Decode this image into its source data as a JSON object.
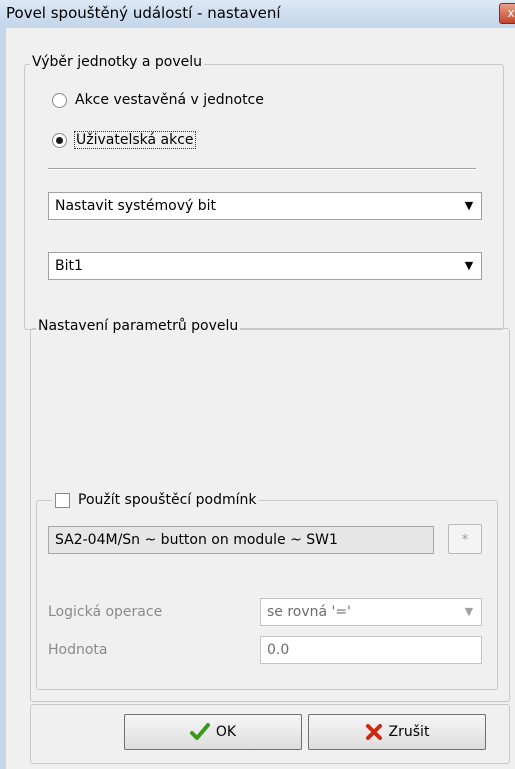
{
  "window": {
    "title": "Povel spouštěný událostí - nastavení",
    "close_glyph": "x"
  },
  "group1": {
    "legend": "Výběr jednotky a povelu",
    "radio_builtin": "Akce vestavěná v jednotce",
    "radio_user": "Uživatelská akce",
    "selected": "radio_user",
    "combo_action": "Nastavit systémový bit",
    "combo_bit": "Bit1"
  },
  "group2": {
    "legend": "Nastavení parametrů povelu",
    "condition": {
      "checkbox_label": "Použít spouštěcí podmínk",
      "checked": false,
      "source_value": "SA2-04M/Sn ~ button on module ~ SW1",
      "browse_label": "*",
      "operation_label": "Logická operace",
      "operation_value": "se rovná '='",
      "value_label": "Hodnota",
      "value_value": "0.0"
    }
  },
  "buttons": {
    "ok_label": "OK",
    "cancel_label": "Zrušit"
  },
  "colors": {
    "ok_icon": "#3a9a1a",
    "cancel_icon": "#cc2a10",
    "title_bar": "#c6d6e9"
  },
  "icons": {
    "ok": "check-icon",
    "cancel": "x-icon",
    "dropdown": "chevron-down-icon"
  }
}
